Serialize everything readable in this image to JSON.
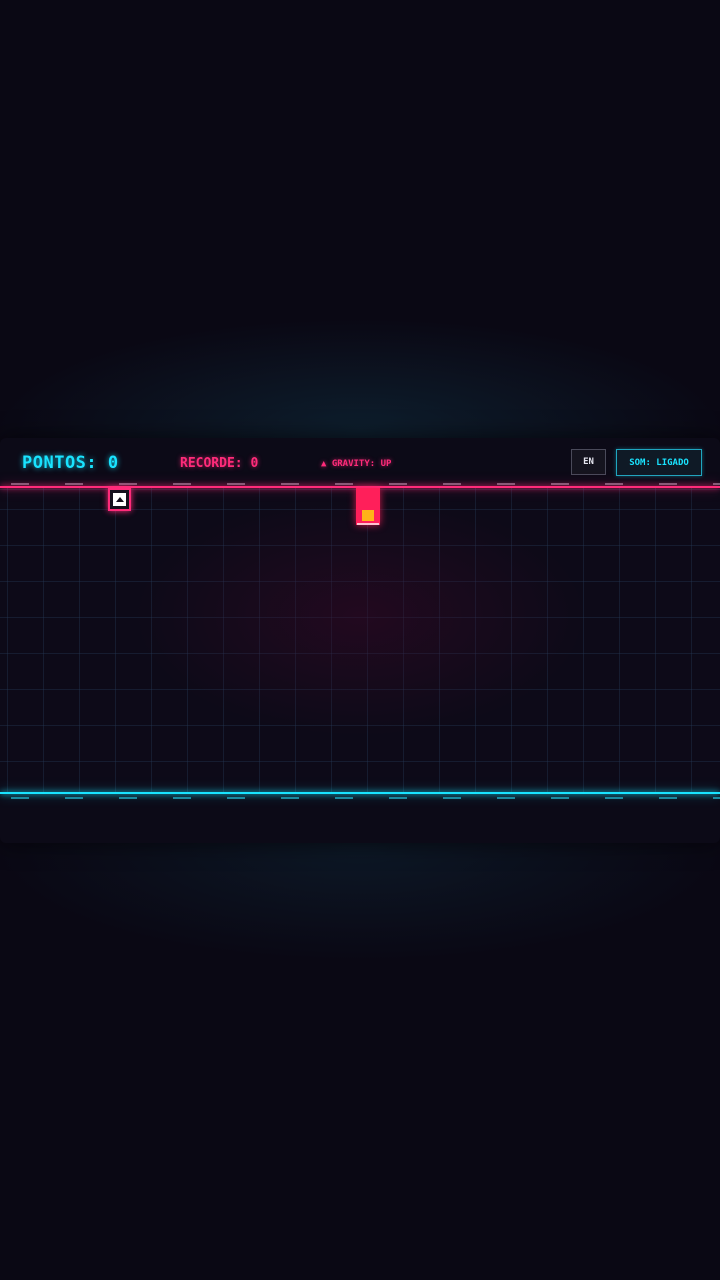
{
  "hud": {
    "score_label": "PONTOS: 0",
    "best_label": "RECORDE: 0",
    "gravity_label": "▲ GRAVITY: UP",
    "language_button": "EN",
    "sound_button": "SOM: LIGADO"
  },
  "colors": {
    "accent_cyan": "#19e3ff",
    "accent_pink": "#ff2b7a",
    "obstacle": "#ff1f5a",
    "coin": "#ffb319",
    "background": "#0a0814"
  },
  "icons": {
    "player": "up-arrow-cube-icon"
  }
}
